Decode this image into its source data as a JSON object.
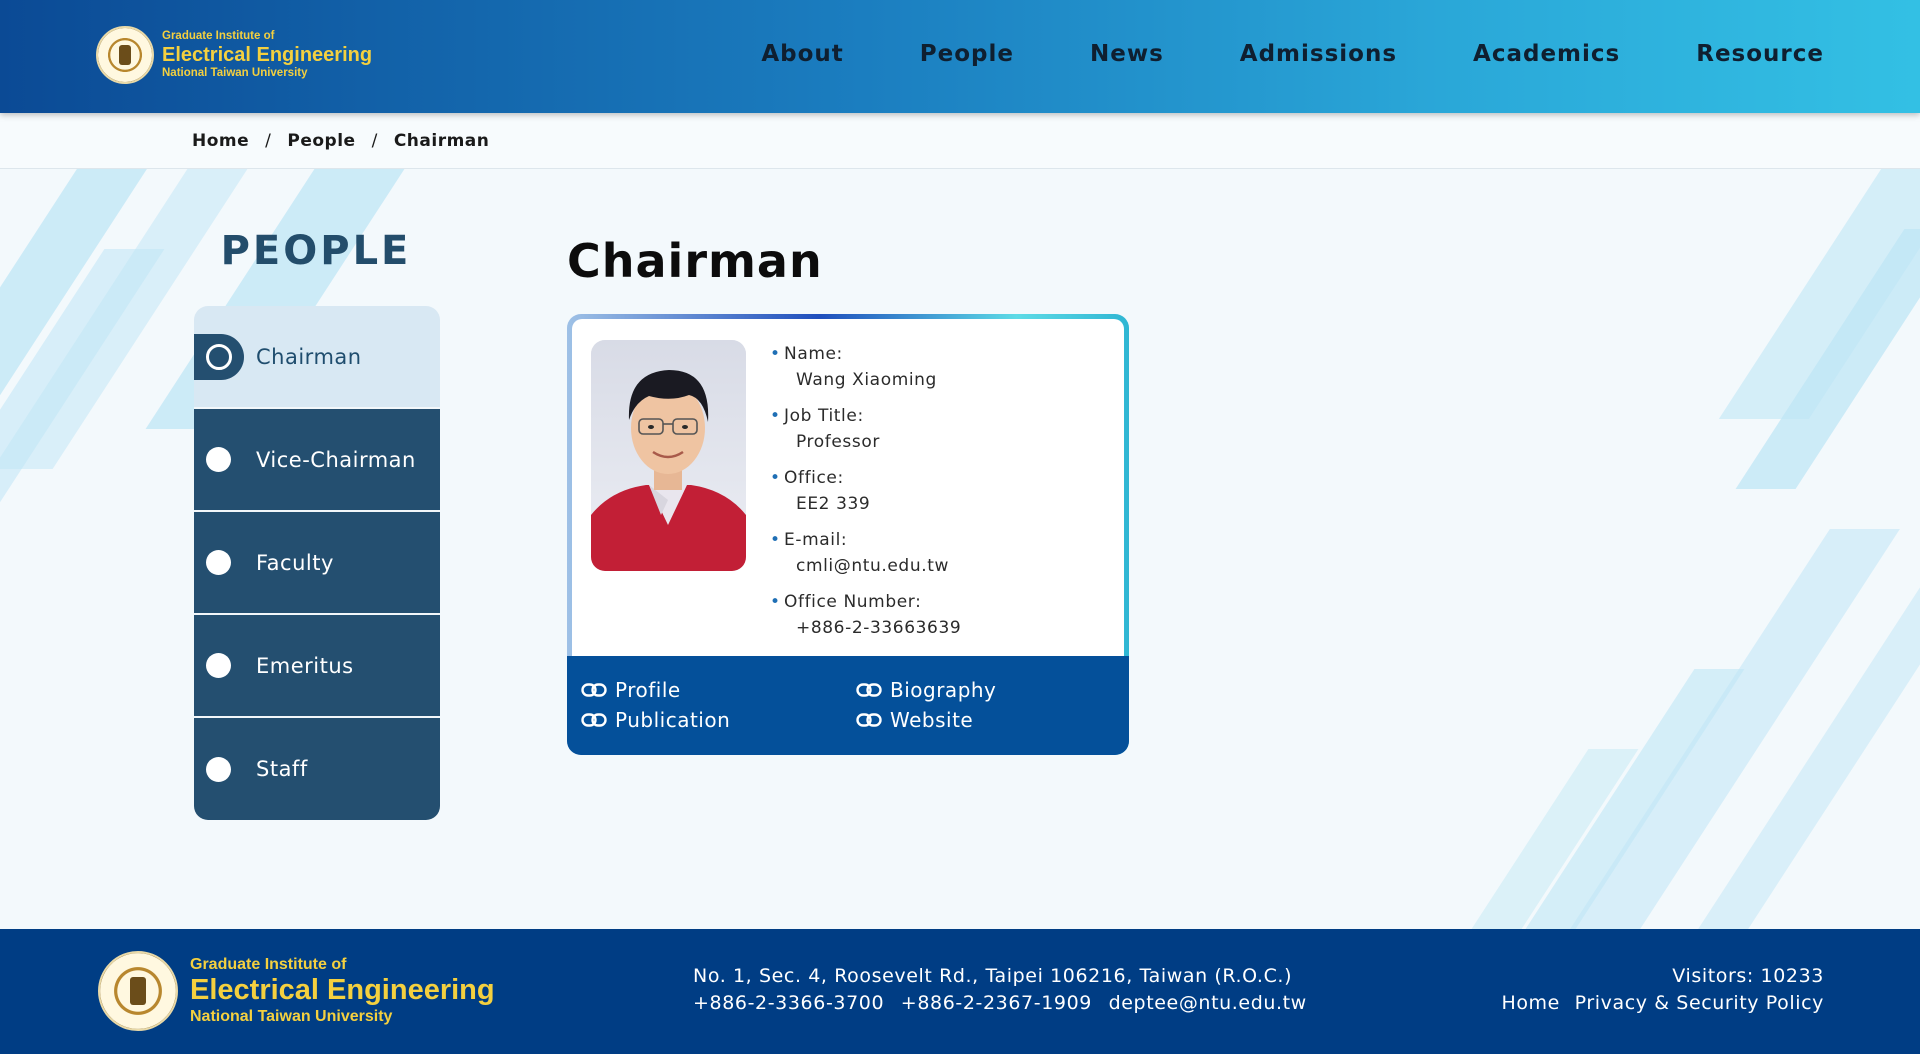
{
  "header": {
    "logo": {
      "line1": "Graduate Institute of",
      "line2": "Electrical Engineering",
      "line3": "National Taiwan University"
    },
    "nav": [
      "About",
      "People",
      "News",
      "Admissions",
      "Academics",
      "Resource"
    ]
  },
  "breadcrumb": {
    "home": "Home",
    "people": "People",
    "current": "Chairman",
    "separator": "/"
  },
  "sidebar": {
    "title": "PEOPLE",
    "items": [
      {
        "label": "Chairman",
        "active": true
      },
      {
        "label": "Vice-Chairman",
        "active": false
      },
      {
        "label": "Faculty",
        "active": false
      },
      {
        "label": "Emeritus",
        "active": false
      },
      {
        "label": "Staff",
        "active": false
      }
    ]
  },
  "main": {
    "title": "Chairman",
    "person": {
      "fields": [
        {
          "key": "Name:",
          "value": "Wang Xiaoming"
        },
        {
          "key": "Job Title:",
          "value": "Professor"
        },
        {
          "key": "Office:",
          "value": "EE2 339"
        },
        {
          "key": "E-mail:",
          "value": "cmli@ntu.edu.tw"
        },
        {
          "key": "Office Number:",
          "value": "+886-2-33663639"
        }
      ]
    },
    "links": [
      "Profile",
      "Biography",
      "Publication",
      "Website"
    ]
  },
  "footer": {
    "logo": {
      "line1": "Graduate Institute of",
      "line2": "Electrical Engineering",
      "line3": "National Taiwan University"
    },
    "address": "No. 1, Sec. 4, Roosevelt Rd., Taipei 106216, Taiwan (R.O.C.)",
    "phone1": "+886-2-3366-3700",
    "phone2": "+886-2-2367-1909",
    "email": "deptee@ntu.edu.tw",
    "visitors": "Visitors: 10233",
    "home_link": "Home",
    "privacy_link": "Privacy & Security Policy"
  },
  "colors": {
    "header_start": "#0b4a95",
    "header_end": "#33c0e4",
    "sidebar": "#244f70",
    "footer": "#003d84",
    "logo_gold": "#f4d03f",
    "link_bar": "#04509a"
  }
}
